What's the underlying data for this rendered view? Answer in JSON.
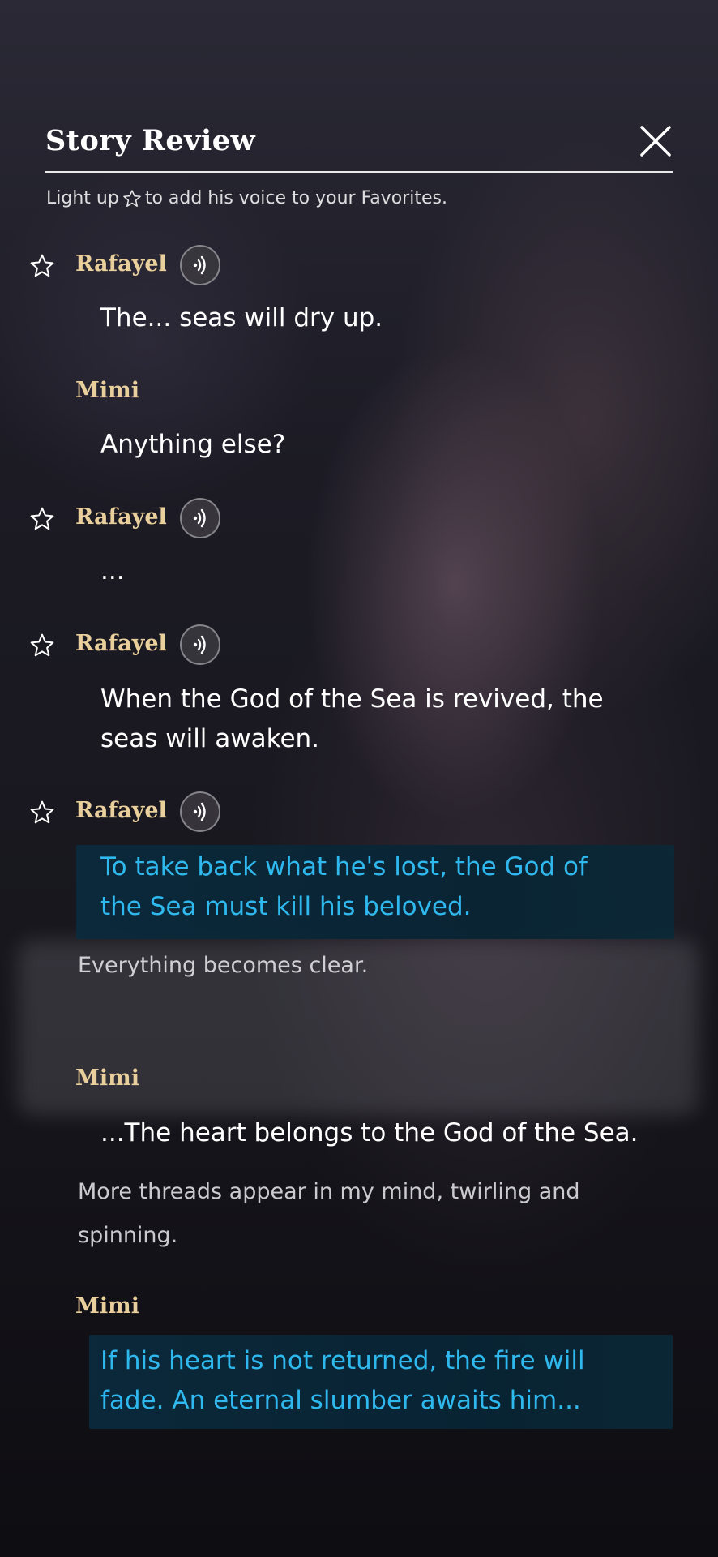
{
  "header": {
    "title": "Story Review",
    "hint": [
      "Light up",
      "to add his voice to your Favorites."
    ]
  },
  "entries": [
    {
      "speaker": "Rafayel",
      "line": "The... seas will dry up."
    },
    {
      "speaker": "Mimi",
      "line": "Anything else?"
    },
    {
      "speaker": "Rafayel",
      "line": "..."
    },
    {
      "speaker": "Rafayel",
      "line": "When the God of the Sea is revived, the seas will awaken."
    },
    {
      "speaker": "Rafayel",
      "line": "To take back what he's lost, the God of the Sea must kill his beloved."
    },
    {
      "narration": "Everything becomes clear."
    },
    {
      "speaker": "Mimi",
      "line": "...The heart belongs to the God of the Sea."
    },
    {
      "narration": "More threads appear in my mind, twirling and spinning."
    },
    {
      "speaker": "Mimi",
      "line": "If his heart is not returned, the fire will fade. An eternal slumber awaits him..."
    }
  ],
  "colors": {
    "speaker_name": "#e9cf9c",
    "highlight_text": "#2fb8ee",
    "highlight_bg": "#0a2a3c"
  }
}
